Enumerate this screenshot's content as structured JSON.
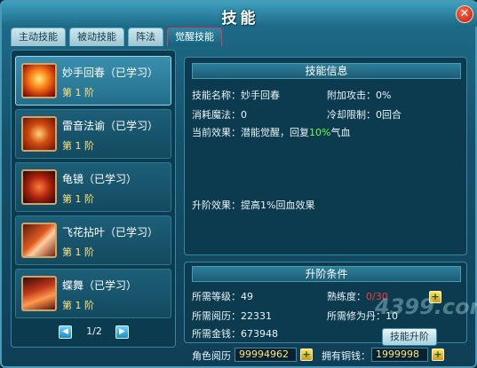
{
  "window": {
    "title": "技能"
  },
  "tabs": [
    {
      "label": "主动技能",
      "active": false
    },
    {
      "label": "被动技能",
      "active": false
    },
    {
      "label": "阵法",
      "active": false
    },
    {
      "label": "觉醒技能",
      "active": true
    }
  ],
  "skills": [
    {
      "name": "妙手回春（已学习）",
      "level": "第 1 阶",
      "icon": "hand-fire-icon",
      "selected": true
    },
    {
      "name": "雷音法谕（已学习）",
      "level": "第 1 阶",
      "icon": "thunder-icon",
      "selected": false
    },
    {
      "name": "龟镜（已学习）",
      "level": "第 1 阶",
      "icon": "shield-icon",
      "selected": false
    },
    {
      "name": "飞花拈叶（已学习）",
      "level": "第 1 阶",
      "icon": "petal-icon",
      "selected": false
    },
    {
      "name": "蝶舞（已学习）",
      "level": "第 1 阶",
      "icon": "butterfly-icon",
      "selected": false
    }
  ],
  "pager": {
    "text": "1/2"
  },
  "info": {
    "header": "技能信息",
    "name_label": "技能名称：",
    "name_value": "妙手回春",
    "extra_attack_label": "附加攻击：",
    "extra_attack_value": "0%",
    "mana_label": "消耗魔法：",
    "mana_value": "0",
    "cooldown_label": "冷却限制：",
    "cooldown_value": "0回合",
    "effect_label": "当前效果：",
    "effect_value_pre": "潜能觉醒，回复",
    "effect_value_pct": "10%",
    "effect_value_post": "气血",
    "upgrade_effect_label": "升阶效果：",
    "upgrade_effect_value": "提高1%回血效果"
  },
  "conditions": {
    "header": "升阶条件",
    "level_label": "所需等级：",
    "level_value": "49",
    "proficiency_label": "熟练度：",
    "proficiency_value": "0/30",
    "exp_label": "所需阅历：",
    "exp_value": "22331",
    "pill_label": "所需修为丹：",
    "pill_value": "10",
    "gold_label": "所需金钱：",
    "gold_value": "673948",
    "upgrade_button": "技能升阶"
  },
  "footer": {
    "role_exp_label": "角色阅历",
    "role_exp_value": "99994962",
    "copper_label": "拥有铜钱：",
    "copper_value": "1999998"
  },
  "watermark": "4399.com"
}
